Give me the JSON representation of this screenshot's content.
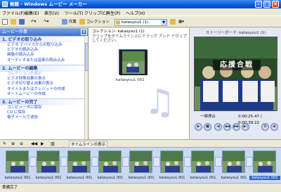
{
  "window": {
    "title": "無題 - Windows ムービー メーカー"
  },
  "menu": [
    "ファイル(F)",
    "編集(E)",
    "表示(V)",
    "ツール(T)",
    "クリップ(C)",
    "再生(P)",
    "ヘルプ(H)"
  ],
  "toolbar": {
    "tasks_label": "作業",
    "collections_label": "コレクション",
    "collection_value": "katasyou1 (1)"
  },
  "task_pane": {
    "title": "ムービー作業",
    "sections": [
      {
        "label": "1. ビデオの取り込み",
        "links": [
          "ビデオ デバイスからの取り込み",
          "ビデオの読み込み",
          "画像の読み込み",
          "オーディオまたは音楽の読み込み"
        ]
      },
      {
        "label": "2. ムービーの編集",
        "links": [
          "コレクションの表示",
          "ビデオ特殊効果の表示",
          "ビデオ切り替え効果の表示",
          "タイトルまたはクレジットの作成",
          "オートムービーの作成"
        ]
      },
      {
        "label": "3. ムービーの完了",
        "links": [
          "コンピュータに保存",
          "CD に保存",
          "電子メールで送信"
        ]
      }
    ]
  },
  "collection": {
    "header_title": "コレクション: katasyou1 (1)",
    "header_hint": "クリップをタイムライン上にドラッグ アンド ドロップしてください。",
    "clip_label": "katasyou1 001"
  },
  "preview": {
    "title": "ストーリーボード: katasyou1 (1)",
    "caption_text": "応援合戦",
    "status": "一時停止",
    "time": "0:00:25.47 / 0:00:39.22"
  },
  "storyboard": {
    "timeline_button": "タイムラインの表示",
    "frame_labels": [
      "katasyou1 001",
      "katasyou1 001",
      "katasyou1 001",
      "katasyou1 001",
      "katasyou1 001",
      "katasyou1 001",
      "katasyou1 001",
      "katasyou1 001",
      "katasyou1 001"
    ],
    "selected_index": 8
  },
  "statusbar": {
    "text": "準備完了"
  },
  "colors": {
    "titlebar": "#0a5ad8",
    "task_link": "#1a48c8",
    "storyboard_bg": "#c9d9f5",
    "selection": "#3166c5"
  }
}
